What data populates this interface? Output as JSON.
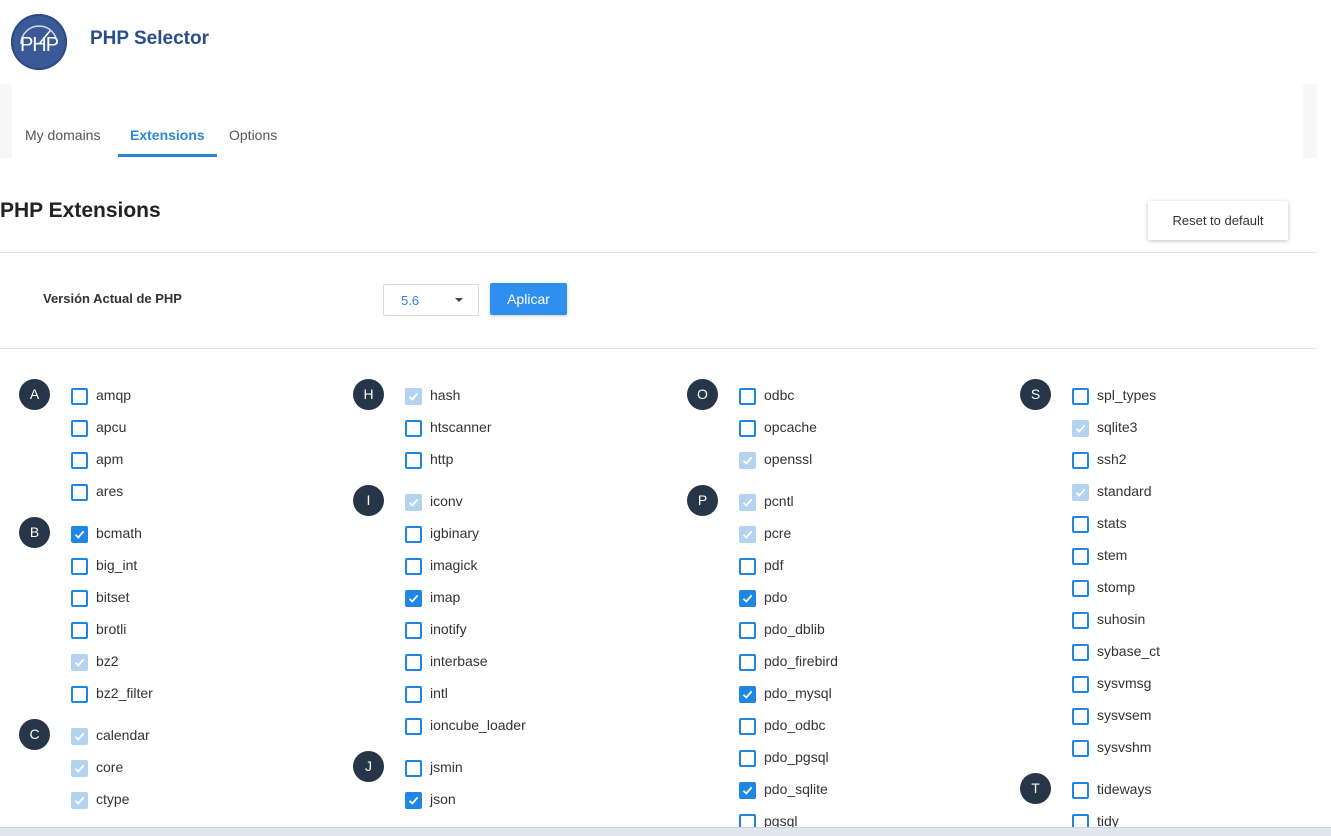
{
  "header": {
    "logo_text": "PHP",
    "title": "PHP Selector"
  },
  "tabs": [
    {
      "label": "My domains",
      "active": false
    },
    {
      "label": "Extensions",
      "active": true
    },
    {
      "label": "Options",
      "active": false
    }
  ],
  "page": {
    "title": "PHP Extensions",
    "reset_label": "Reset to default"
  },
  "version": {
    "label": "Versión Actual de PHP",
    "selected": "5.6",
    "apply_label": "Aplicar"
  },
  "colors": {
    "accent": "#2e86d4",
    "badge": "#263548",
    "checkbox": "#1f86e6",
    "checkbox_disabled": "#b3d3f0"
  },
  "columns": [
    {
      "groups": [
        {
          "letter": "A",
          "items": [
            {
              "name": "amqp",
              "state": "unchecked"
            },
            {
              "name": "apcu",
              "state": "unchecked"
            },
            {
              "name": "apm",
              "state": "unchecked"
            },
            {
              "name": "ares",
              "state": "unchecked"
            }
          ]
        },
        {
          "letter": "B",
          "items": [
            {
              "name": "bcmath",
              "state": "checked"
            },
            {
              "name": "big_int",
              "state": "unchecked"
            },
            {
              "name": "bitset",
              "state": "unchecked"
            },
            {
              "name": "brotli",
              "state": "unchecked"
            },
            {
              "name": "bz2",
              "state": "disabled"
            },
            {
              "name": "bz2_filter",
              "state": "unchecked"
            }
          ]
        },
        {
          "letter": "C",
          "items": [
            {
              "name": "calendar",
              "state": "disabled"
            },
            {
              "name": "core",
              "state": "disabled"
            },
            {
              "name": "ctype",
              "state": "disabled"
            }
          ]
        }
      ]
    },
    {
      "groups": [
        {
          "letter": "H",
          "items": [
            {
              "name": "hash",
              "state": "disabled"
            },
            {
              "name": "htscanner",
              "state": "unchecked"
            },
            {
              "name": "http",
              "state": "unchecked"
            }
          ]
        },
        {
          "letter": "I",
          "items": [
            {
              "name": "iconv",
              "state": "disabled"
            },
            {
              "name": "igbinary",
              "state": "unchecked"
            },
            {
              "name": "imagick",
              "state": "unchecked"
            },
            {
              "name": "imap",
              "state": "checked"
            },
            {
              "name": "inotify",
              "state": "unchecked"
            },
            {
              "name": "interbase",
              "state": "unchecked"
            },
            {
              "name": "intl",
              "state": "unchecked"
            },
            {
              "name": "ioncube_loader",
              "state": "unchecked"
            }
          ]
        },
        {
          "letter": "J",
          "items": [
            {
              "name": "jsmin",
              "state": "unchecked"
            },
            {
              "name": "json",
              "state": "checked"
            }
          ]
        }
      ]
    },
    {
      "groups": [
        {
          "letter": "O",
          "items": [
            {
              "name": "odbc",
              "state": "unchecked"
            },
            {
              "name": "opcache",
              "state": "unchecked"
            },
            {
              "name": "openssl",
              "state": "disabled"
            }
          ]
        },
        {
          "letter": "P",
          "items": [
            {
              "name": "pcntl",
              "state": "disabled"
            },
            {
              "name": "pcre",
              "state": "disabled"
            },
            {
              "name": "pdf",
              "state": "unchecked"
            },
            {
              "name": "pdo",
              "state": "checked"
            },
            {
              "name": "pdo_dblib",
              "state": "unchecked"
            },
            {
              "name": "pdo_firebird",
              "state": "unchecked"
            },
            {
              "name": "pdo_mysql",
              "state": "checked"
            },
            {
              "name": "pdo_odbc",
              "state": "unchecked"
            },
            {
              "name": "pdo_pgsql",
              "state": "unchecked"
            },
            {
              "name": "pdo_sqlite",
              "state": "checked"
            },
            {
              "name": "pgsql",
              "state": "unchecked"
            }
          ]
        }
      ]
    },
    {
      "groups": [
        {
          "letter": "S",
          "items": [
            {
              "name": "spl_types",
              "state": "unchecked"
            },
            {
              "name": "sqlite3",
              "state": "disabled"
            },
            {
              "name": "ssh2",
              "state": "unchecked"
            },
            {
              "name": "standard",
              "state": "disabled"
            },
            {
              "name": "stats",
              "state": "unchecked"
            },
            {
              "name": "stem",
              "state": "unchecked"
            },
            {
              "name": "stomp",
              "state": "unchecked"
            },
            {
              "name": "suhosin",
              "state": "unchecked"
            },
            {
              "name": "sybase_ct",
              "state": "unchecked"
            },
            {
              "name": "sysvmsg",
              "state": "unchecked"
            },
            {
              "name": "sysvsem",
              "state": "unchecked"
            },
            {
              "name": "sysvshm",
              "state": "unchecked"
            }
          ]
        },
        {
          "letter": "T",
          "items": [
            {
              "name": "tideways",
              "state": "unchecked"
            },
            {
              "name": "tidy",
              "state": "unchecked"
            }
          ]
        }
      ]
    }
  ]
}
